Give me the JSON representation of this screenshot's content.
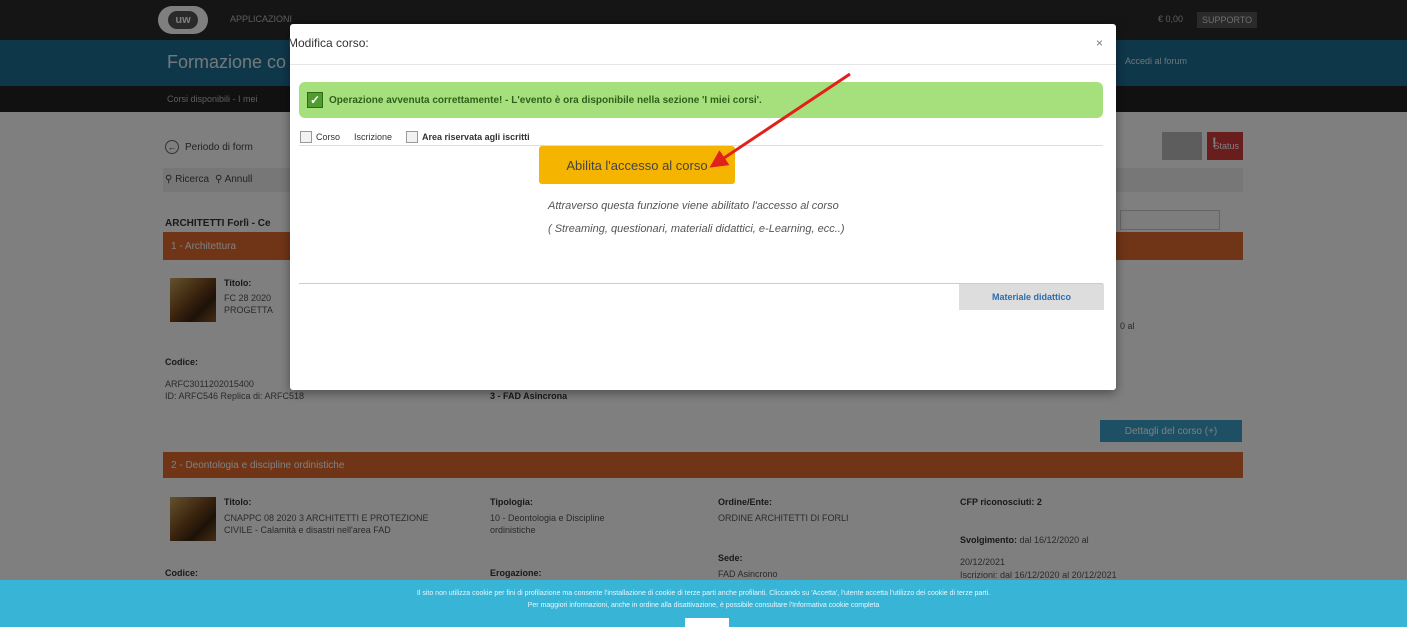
{
  "topbar": {
    "logo": "uw",
    "nav_first": "APPLICAZIONI",
    "right_item": "€ 0,00",
    "support": "SUPPORTO"
  },
  "page": {
    "title": "Formazione co",
    "forum_link": "Accedi al forum",
    "subnav": "Corsi disponibili - I mei",
    "periodo": "Periodo di form",
    "ricerca": "Ricerca",
    "annulla": "Annull",
    "status": "Status",
    "filter_title": "ARCHITETTI Forlì - Ce",
    "dettagli": "Dettagli del corso (+)"
  },
  "course1": {
    "header": "1 - Architettura",
    "titolo_label": "Titolo:",
    "titolo_line1": "FC 28 2020",
    "titolo_line2": "PROGETTA",
    "codice_label": "Codice:",
    "codice": "ARFC3011202015400",
    "id_text": "ID: ARFC546 Replica di: ARFC518",
    "erogazione": "3 - FAD Asincrona",
    "date_suffix": "0 al"
  },
  "course2": {
    "header": "2 - Deontologia e discipline ordinistiche",
    "titolo_label": "Titolo:",
    "titolo_line1": "CNAPPC 08 2020 3 ARCHITETTI E PROTEZIONE",
    "titolo_line2": "CIVILE - Calamità e disastri nell'area FAD",
    "tipologia_label": "Tipologia:",
    "tipologia_line1": "10 - Deontologia e Discipline",
    "tipologia_line2": "ordinistiche",
    "ordine_label": "Ordine/Ente:",
    "ordine": "ORDINE ARCHITETTI DI FORLI",
    "sede_label": "Sede:",
    "sede": "FAD Asincrono",
    "cfp_label": "CFP riconosciuti: 2",
    "svolgimento_label": "Svolgimento:",
    "svolgimento": "dal 16/12/2020 al",
    "svolgimento_end": "20/12/2021",
    "iscrizioni": "Iscrizioni: dal 16/12/2020 al 20/12/2021",
    "codice_label": "Codice:",
    "erogazione_label": "Erogazione:"
  },
  "modal": {
    "title": "Modifica corso:",
    "close": "×",
    "success_message": "Operazione avvenuta correttamente! - L'evento è ora disponibile nella sezione 'I miei corsi'.",
    "tabs": [
      {
        "label": "Corso"
      },
      {
        "label": "Iscrizione"
      },
      {
        "label": "Area riservata agli iscritti"
      }
    ],
    "abilita_button": "Abilita l'accesso al corso",
    "description_line1": "Attraverso questa funzione viene abilitato l'accesso al corso",
    "description_line2": "( Streaming, questionari, materiali didattici, e-Learning, ecc..)",
    "materiale_button": "Materiale didattico"
  },
  "cookie": {
    "line1": "Il sito non utilizza cookie per fini di profilazione ma consente l'installazione di cookie di terze parti anche profilanti. Cliccando su 'Accetta', l'utente accetta l'utilizzo dei cookie di terze parti.",
    "line2": "Per maggiori informazioni, anche in ordine alla disattivazione, è possibile consultare l'Informativa cookie completa"
  },
  "colors": {
    "accent_orange": "#e06a2f",
    "alert_green": "#a6e07c",
    "button_yellow": "#f5b400",
    "cookie_blue": "#38b4d7",
    "arrow_red": "#e0221b"
  }
}
